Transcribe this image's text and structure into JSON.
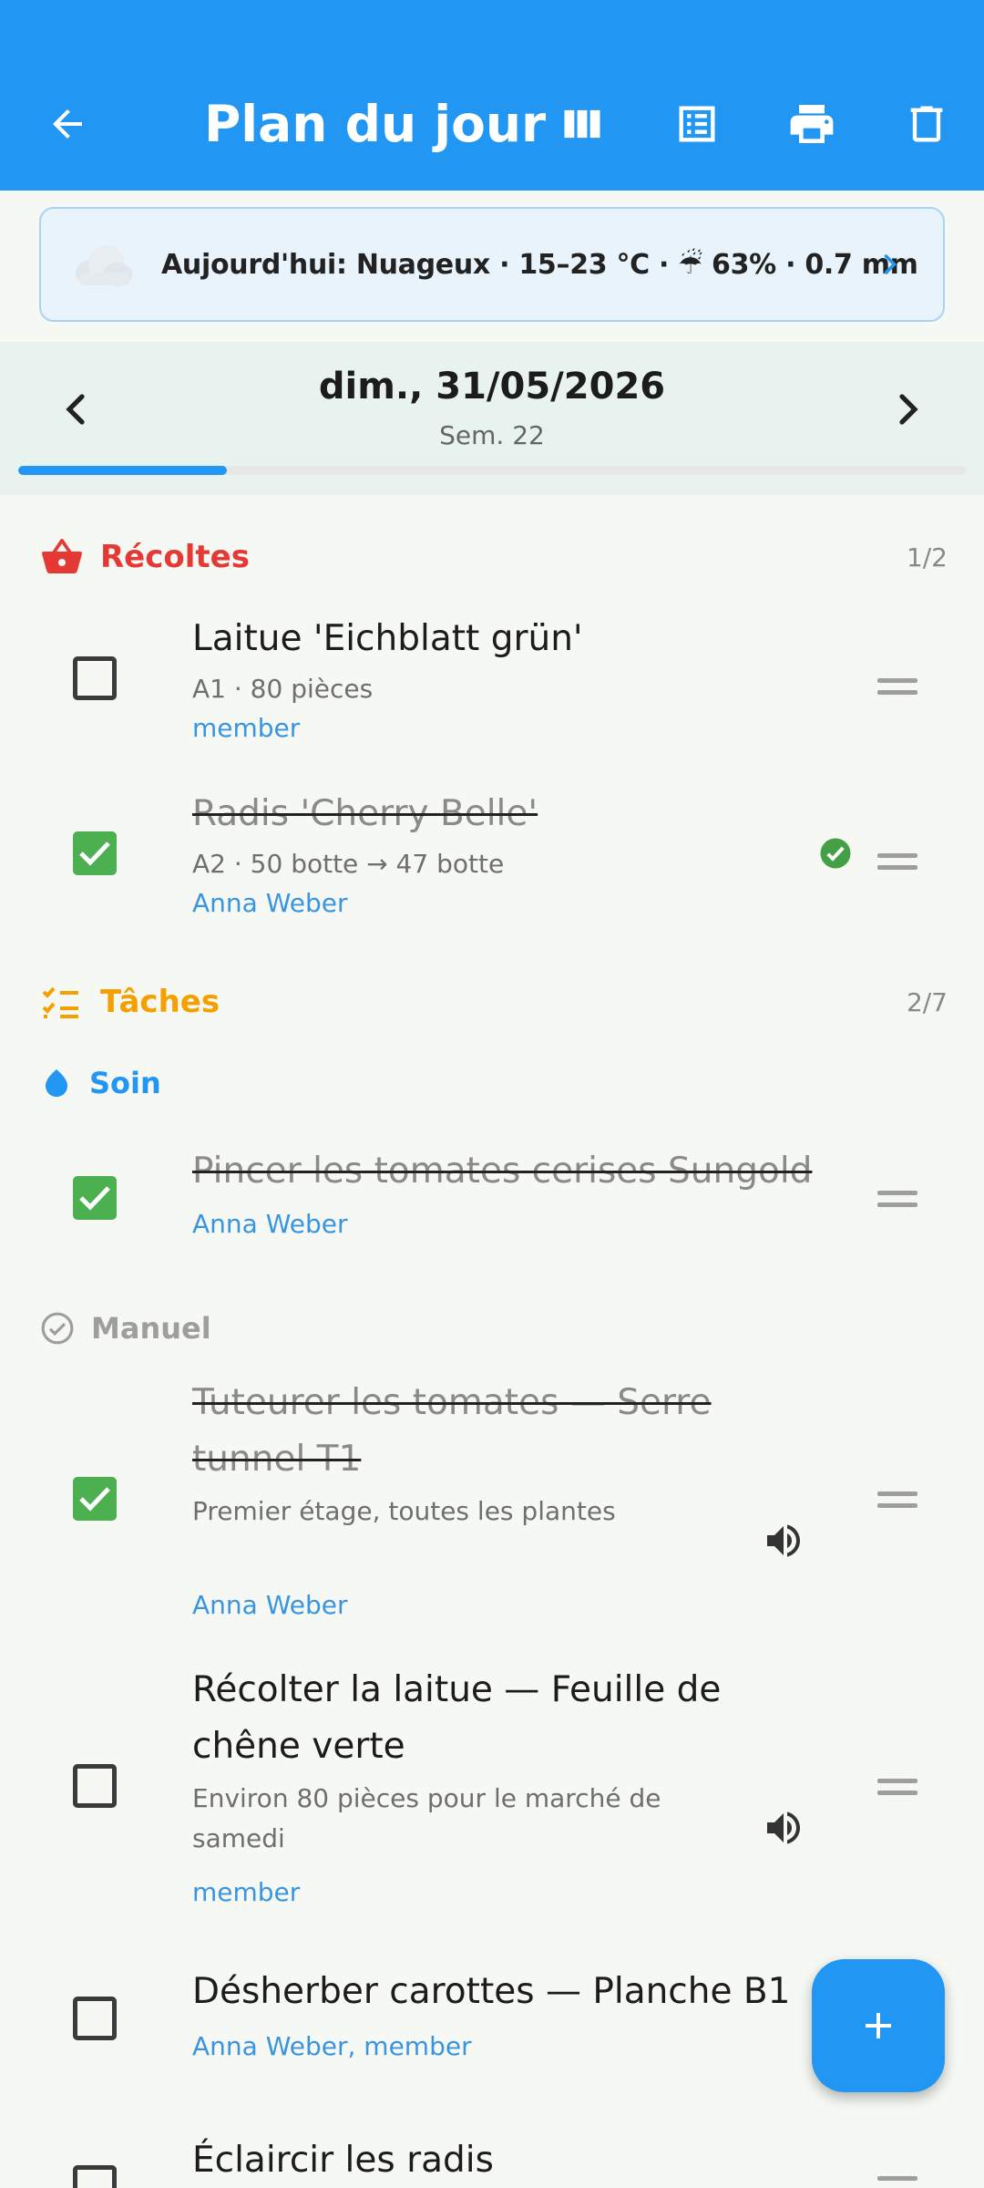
{
  "app_bar": {
    "title": "Plan du jour",
    "icons": [
      "arrow-back-icon",
      "columns-view-icon",
      "list-view-icon",
      "print-icon",
      "delete-icon"
    ]
  },
  "weather": {
    "icon": "cloud-icon",
    "text": "Aujourd'hui: Nuageux · 15–23 °C · ☔ 63% · 0.7 mm"
  },
  "date_nav": {
    "date": "dim., 31/05/2026",
    "week": "Sem. 22",
    "week_progress": 0.22
  },
  "harvests": {
    "label": "Récoltes",
    "count": "1/2",
    "color": "#e53935",
    "items": [
      {
        "title": "Laitue 'Eichblatt grün'",
        "subtitle": "A1 · 80 pièces",
        "assignee": "member",
        "done": false
      },
      {
        "title": "Radis 'Cherry Belle'",
        "subtitle": "A2 · 50 botte → 47 botte",
        "assignee": "Anna Weber",
        "done": true
      }
    ]
  },
  "tasks": {
    "label": "Tâches",
    "count": "2/7",
    "color": "#f59f00",
    "groups": [
      {
        "label": "Soin",
        "color": "#2196f3",
        "items": [
          {
            "title": "Pincer les tomates cerises Sungold",
            "assignee": "Anna Weber",
            "done": true
          }
        ]
      },
      {
        "label": "Manuel",
        "color": "#9e9e9e",
        "items": [
          {
            "title": "Tuteurer les tomates — Serre tunnel T1",
            "note": "Premier étage, toutes les plantes",
            "assignee": "Anna Weber",
            "done": true
          },
          {
            "title": "Récolter la laitue — Feuille de chêne verte",
            "note": "Environ 80 pièces pour le marché de samedi",
            "assignee": "member",
            "done": false
          },
          {
            "title": "Désherber carottes — Planche B1",
            "assignee": "Anna Weber, member",
            "done": false
          },
          {
            "title": "Éclaircir les radis",
            "done": false
          }
        ]
      }
    ]
  },
  "fab": {
    "icon": "add-icon"
  }
}
